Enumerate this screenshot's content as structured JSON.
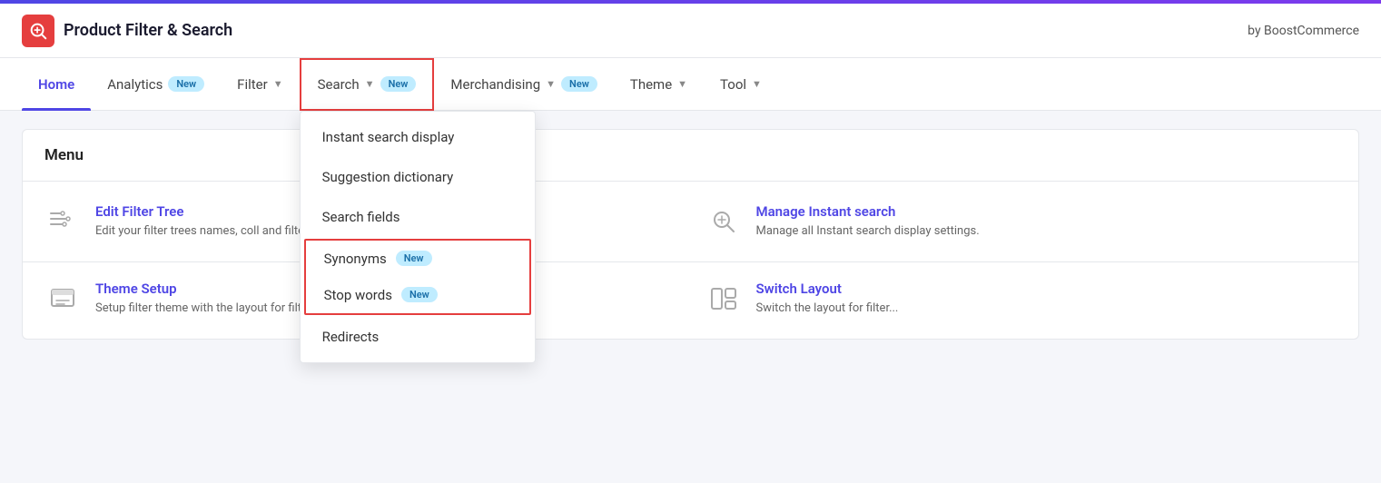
{
  "app": {
    "title": "Product Filter & Search",
    "byline": "by BoostCommerce"
  },
  "nav": {
    "items": [
      {
        "id": "home",
        "label": "Home",
        "active": true,
        "badge": null,
        "chevron": false
      },
      {
        "id": "analytics",
        "label": "Analytics",
        "active": false,
        "badge": "New",
        "chevron": false
      },
      {
        "id": "filter",
        "label": "Filter",
        "active": false,
        "badge": null,
        "chevron": true
      },
      {
        "id": "search",
        "label": "Search",
        "active": false,
        "badge": "New",
        "chevron": true,
        "highlighted": true
      },
      {
        "id": "merchandising",
        "label": "Merchandising",
        "active": false,
        "badge": "New",
        "chevron": true
      },
      {
        "id": "theme",
        "label": "Theme",
        "active": false,
        "badge": null,
        "chevron": true
      },
      {
        "id": "tool",
        "label": "Tool",
        "active": false,
        "badge": null,
        "chevron": true
      }
    ]
  },
  "search_dropdown": {
    "items": [
      {
        "id": "instant-search-display",
        "label": "Instant search display",
        "badge": null,
        "highlighted": false
      },
      {
        "id": "suggestion-dictionary",
        "label": "Suggestion dictionary",
        "badge": null,
        "highlighted": false
      },
      {
        "id": "search-fields",
        "label": "Search fields",
        "badge": null,
        "highlighted": false
      },
      {
        "id": "synonyms",
        "label": "Synonyms",
        "badge": "New",
        "highlighted": true,
        "group_start": true
      },
      {
        "id": "stop-words",
        "label": "Stop words",
        "badge": "New",
        "highlighted": true,
        "group_end": true
      },
      {
        "id": "redirects",
        "label": "Redirects",
        "badge": null,
        "highlighted": false
      }
    ]
  },
  "menu_section": {
    "title": "Menu",
    "items": [
      {
        "id": "edit-filter-tree",
        "title": "Edit Filter Tree",
        "description": "Edit your filter trees names, coll and filter options.",
        "icon": "filter-tree-icon"
      },
      {
        "id": "manage-instant-search",
        "title": "Manage Instant search",
        "description": "Manage all Instant search display settings.",
        "icon": "instant-search-icon"
      }
    ]
  },
  "menu_section2": {
    "items": [
      {
        "id": "theme-setup",
        "title": "Theme Setup",
        "description": "Setup filter theme with the layout for filter...",
        "icon": "theme-icon"
      },
      {
        "id": "switch-layout",
        "title": "Switch Layout",
        "description": "Switch the layout for filter...",
        "icon": "switch-layout-icon"
      }
    ]
  }
}
